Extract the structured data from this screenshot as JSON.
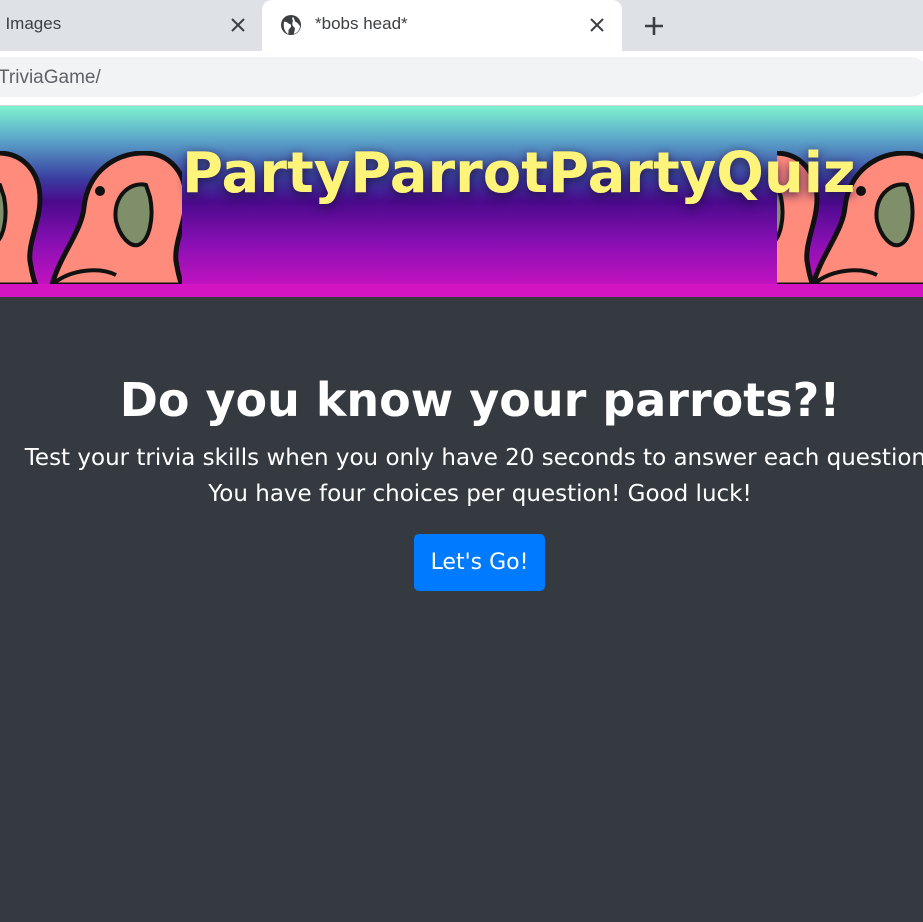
{
  "browser": {
    "tabs": [
      {
        "title": ". Images",
        "close_icon": "close-icon"
      },
      {
        "title": "*bobs head*",
        "favicon": "globe-icon",
        "close_icon": "close-icon"
      }
    ],
    "new_tab_icon": "plus-icon",
    "url": "TriviaGame/"
  },
  "banner": {
    "title": "PartyParrotPartyQuiz",
    "title_color": "#fff47a",
    "decoration": "party-parrot-icon"
  },
  "main": {
    "heading": "Do you know your parrots?!",
    "line1": "Test your trivia skills when you only have 20 seconds to answer each question!",
    "line2": "You have four choices per question! Good luck!",
    "start_button": "Let's Go!",
    "button_color": "#007bff",
    "background": "#343a40"
  }
}
